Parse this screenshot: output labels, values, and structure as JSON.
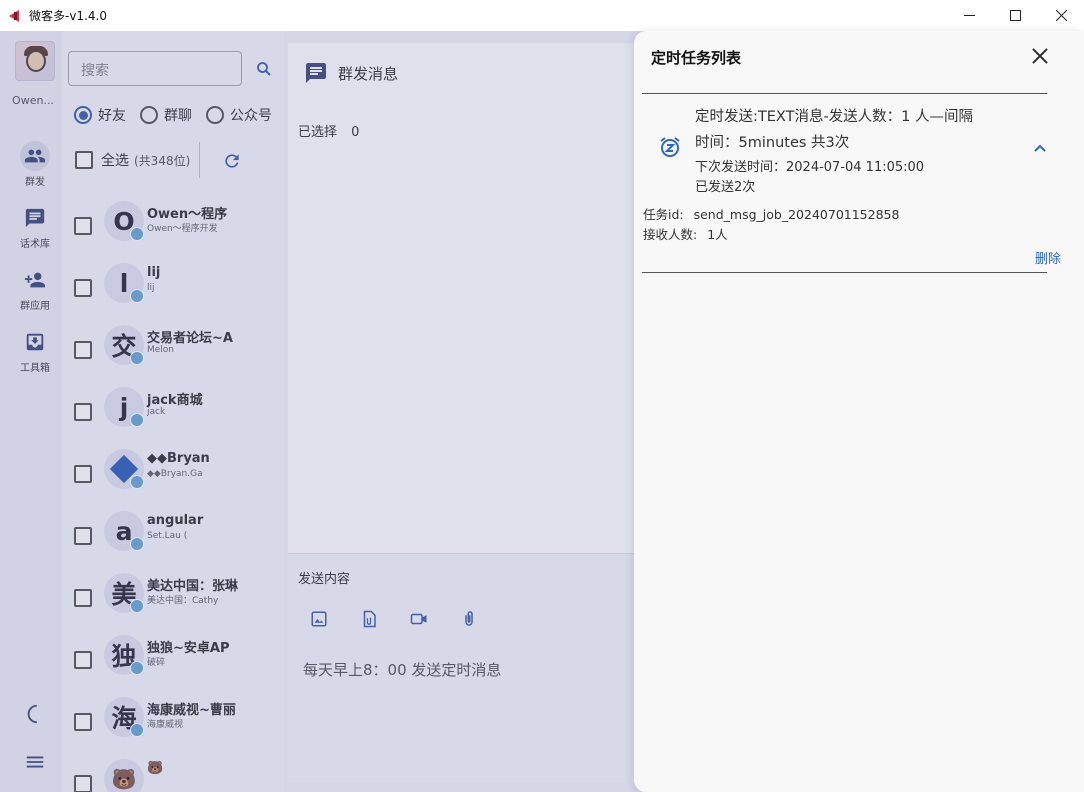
{
  "window": {
    "title": "微客多-v1.4.0",
    "controls": {
      "minimize": "—",
      "maximize": "☐",
      "close": "✕"
    }
  },
  "sidebar": {
    "username": "Owen...",
    "items": [
      {
        "label": "群发",
        "icon": "group-icon",
        "active": true
      },
      {
        "label": "话术库",
        "icon": "message-icon",
        "active": false
      },
      {
        "label": "群应用",
        "icon": "add-group-icon",
        "active": false
      },
      {
        "label": "工具箱",
        "icon": "toolbox-icon",
        "active": false
      }
    ],
    "bottom": [
      {
        "icon": "moon-icon"
      },
      {
        "icon": "menu-icon"
      }
    ]
  },
  "contacts": {
    "search_placeholder": "搜索",
    "filters": [
      {
        "label": "好友",
        "selected": true
      },
      {
        "label": "群聊",
        "selected": false
      },
      {
        "label": "公众号",
        "selected": false
      }
    ],
    "select_all_label": "全选",
    "select_all_count": "(共348位)",
    "list": [
      {
        "avatar": "O",
        "name": "Owen～程序",
        "sub": "Owen～程序开发"
      },
      {
        "avatar": "l",
        "name": "lij",
        "sub": "lij"
      },
      {
        "avatar": "交",
        "name": "交易者论坛~A",
        "sub": "Melon"
      },
      {
        "avatar": "j",
        "name": "jack商城",
        "sub": "jack"
      },
      {
        "avatar": "◆",
        "name": "◆◆Bryan",
        "sub": "◆◆Bryan.Ga"
      },
      {
        "avatar": "a",
        "name": "angular",
        "sub": "Set.Lau ("
      },
      {
        "avatar": "美",
        "name": "美达中国：张琳",
        "sub": "美达中国：Cathy"
      },
      {
        "avatar": "独",
        "name": "独狼~安卓AP",
        "sub": "破碎"
      },
      {
        "avatar": "海",
        "name": "海康威视~曹丽",
        "sub": "海康威视"
      },
      {
        "avatar": "🐻",
        "name": "🐻",
        "sub": ""
      }
    ]
  },
  "main": {
    "header": "群发消息",
    "selected_label": "已选择",
    "selected_count": "0",
    "send_label": "发送内容",
    "send_tools": [
      "image-icon",
      "file-icon",
      "video-icon",
      "attachment-icon"
    ],
    "send_text": "每天早上8：00 发送定时消息"
  },
  "drawer": {
    "title": "定时任务列表",
    "task": {
      "line1": "定时发送:TEXT消息-发送人数：1 人—间隔",
      "line2": "时间：5minutes 共3次",
      "next_send": "下次发送时间：2024-07-04 11:05:00",
      "sent": "已发送2次",
      "id_label": "任务id:",
      "id_value": "send_msg_job_20240701152858",
      "receivers_label": "接收人数:",
      "receivers_value": "1人",
      "delete_label": "删除"
    }
  },
  "colors": {
    "accent": "#3f5fa8",
    "link": "#2f66c9",
    "overlay": "rgba(95,100,160,0.20)",
    "brand": "#d8314c"
  }
}
